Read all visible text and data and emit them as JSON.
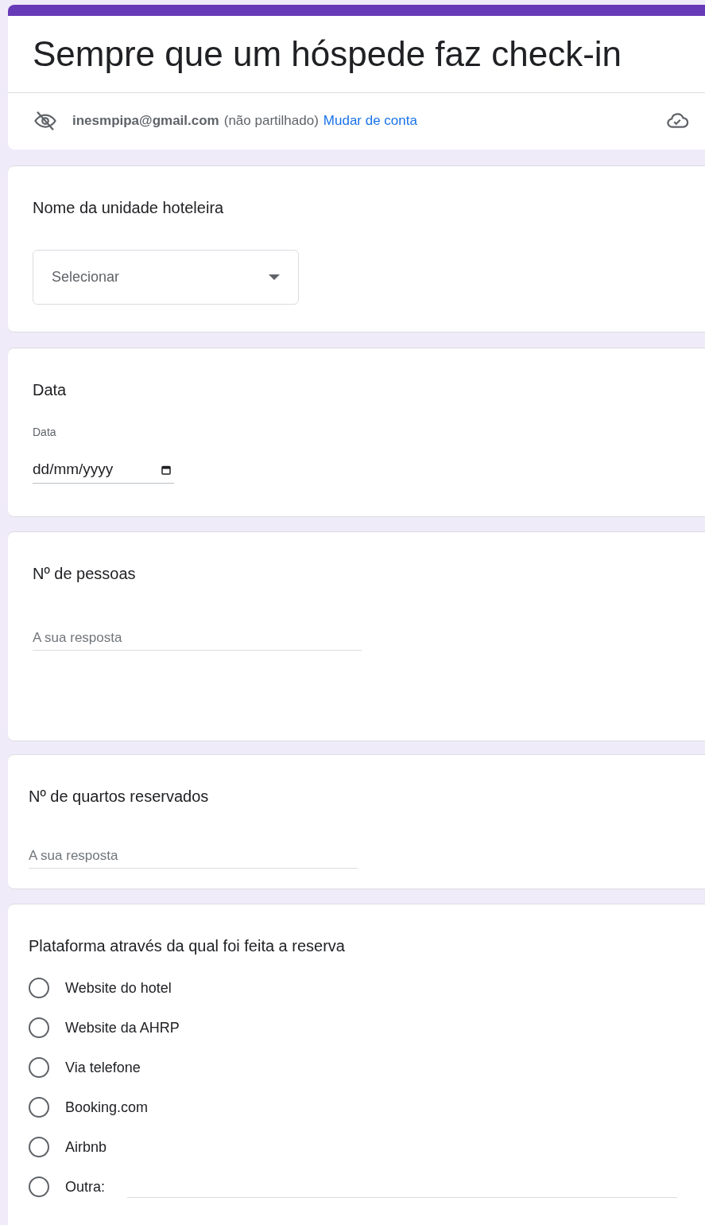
{
  "form": {
    "title": "Sempre que um hóspede faz check-in",
    "account": {
      "email": "inesmpipa@gmail.com",
      "note": "(não partilhado)",
      "switch_link": "Mudar de conta"
    }
  },
  "questions": [
    {
      "kind": "dropdown",
      "title": "Nome da unidade hoteleira",
      "placeholder": "Selecionar"
    },
    {
      "kind": "date",
      "title": "Data",
      "field_label": "Data",
      "placeholder": "dd/mm/yyyy"
    },
    {
      "kind": "short_text",
      "title": "Nº de pessoas",
      "placeholder": "A sua resposta"
    },
    {
      "kind": "short_text",
      "title": "Nº de quartos reservados",
      "placeholder": "A sua resposta"
    },
    {
      "kind": "radio",
      "title": "Plataforma através da qual foi feita a reserva",
      "options": [
        {
          "kind": "choice",
          "label": "Website do hotel",
          "selected": false
        },
        {
          "kind": "choice",
          "label": "Website da AHRP",
          "selected": false
        },
        {
          "kind": "choice",
          "label": "Via telefone",
          "selected": false
        },
        {
          "kind": "choice",
          "label": "Booking.com",
          "selected": false
        },
        {
          "kind": "choice",
          "label": "Airbnb",
          "selected": false
        },
        {
          "kind": "other",
          "label": "Outra:",
          "selected": false
        }
      ]
    }
  ]
}
